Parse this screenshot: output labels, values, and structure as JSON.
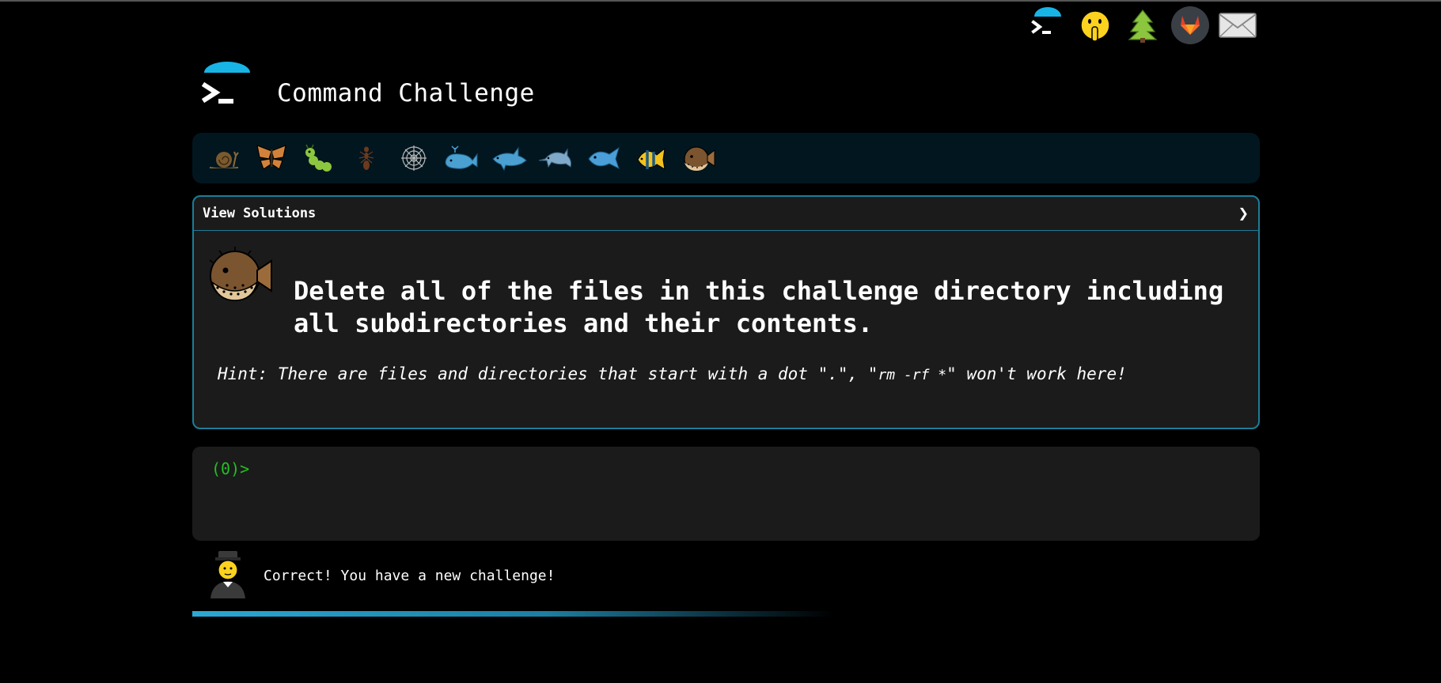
{
  "app": {
    "title": "Command Challenge"
  },
  "topnav": {
    "icons": [
      "terminal-logo-icon",
      "shushing-face-icon",
      "tree-icon",
      "gitlab-icon",
      "envelope-icon"
    ]
  },
  "levels": [
    "snail-icon",
    "butterfly-icon",
    "caterpillar-icon",
    "ant-icon",
    "spiderweb-icon",
    "whale-icon",
    "shark-icon",
    "dolphin-icon",
    "fish-icon",
    "tropical-fish-icon",
    "blowfish-icon"
  ],
  "challenge": {
    "solutions_label": "View Solutions",
    "chevron": "❯",
    "text": "Delete all of the files in this challenge directory including all subdirectories and their contents.",
    "hint_prefix": "Hint: There are files and directories that start with a dot \".\", \"",
    "hint_command": "rm -rf *",
    "hint_suffix": "\" won't work here!"
  },
  "terminal": {
    "prompt": "(0)>"
  },
  "feedback": {
    "message": "Correct! You have a new challenge!"
  },
  "colors": {
    "accent": "#1b7d98",
    "prompt": "#20c020",
    "level_bar": "#02161f",
    "panel": "#1b1b1b"
  }
}
